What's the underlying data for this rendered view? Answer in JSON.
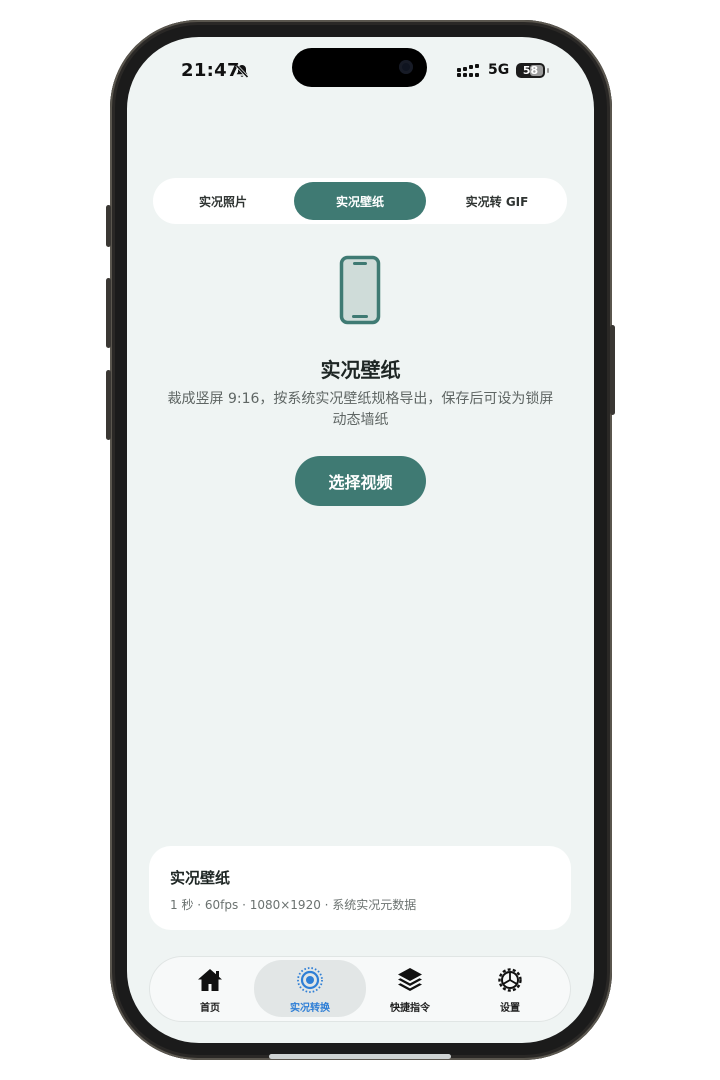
{
  "status": {
    "time": "21:47",
    "network": "5G",
    "battery": "58"
  },
  "segment": {
    "tabs": [
      {
        "label": "实况照片"
      },
      {
        "label": "实况壁纸"
      },
      {
        "label": "实况转 GIF"
      }
    ],
    "active": "实况壁纸"
  },
  "hero": {
    "icon": "phone-icon",
    "title": "实况壁纸",
    "description": "裁成竖屏 9:16，按系统实况壁纸规格导出，保存后可设为锁屏动态墙纸",
    "button_label": "选择视频"
  },
  "info_card": {
    "title": "实况壁纸",
    "meta": "1 秒 · 60fps · 1080×1920 · 系统实况元数据"
  },
  "tabbar": {
    "items": [
      {
        "label": "首页",
        "icon": "home-icon"
      },
      {
        "label": "实况转换",
        "icon": "live-icon"
      },
      {
        "label": "快捷指令",
        "icon": "layers-icon"
      },
      {
        "label": "设置",
        "icon": "gear-icon"
      }
    ],
    "active": "实况转换"
  },
  "colors": {
    "accent": "#3f7a73",
    "background": "#eff4f3",
    "active_tab_text": "#2f7fd6"
  }
}
